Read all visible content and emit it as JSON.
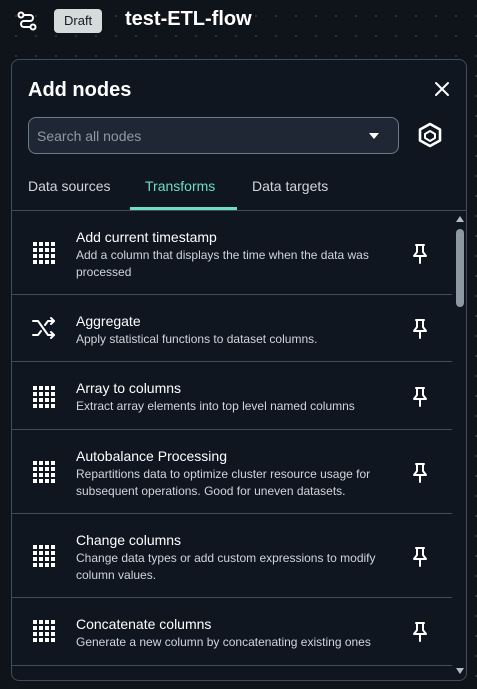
{
  "topbar": {
    "badge": "Draft",
    "flow_name": "test-ETL-flow",
    "flow_icon": "flow-graph-icon"
  },
  "panel": {
    "title": "Add nodes",
    "close_icon": "close-icon",
    "search": {
      "placeholder": "Search all nodes",
      "value": ""
    },
    "brand_icon": "hexagon-logo-icon",
    "tabs": [
      {
        "label": "Data sources",
        "active": false
      },
      {
        "label": "Transforms",
        "active": true
      },
      {
        "label": "Data targets",
        "active": false
      }
    ],
    "items": [
      {
        "title": "Add current timestamp",
        "description": "Add a column that displays the time when the data was processed",
        "icon": "grid-table-icon"
      },
      {
        "title": "Aggregate",
        "description": "Apply statistical functions to dataset columns.",
        "icon": "shuffle-icon"
      },
      {
        "title": "Array to columns",
        "description": "Extract array elements into top level named columns",
        "icon": "grid-table-icon"
      },
      {
        "title": "Autobalance Processing",
        "description": "Repartitions data to optimize cluster resource usage for subsequent operations. Good for uneven datasets.",
        "icon": "grid-table-icon"
      },
      {
        "title": "Change columns",
        "description": "Change data types or add custom expressions to modify column values.",
        "icon": "grid-table-icon"
      },
      {
        "title": "Concatenate columns",
        "description": "Generate a new column by concatenating existing ones",
        "icon": "grid-table-icon"
      }
    ]
  },
  "colors": {
    "accent": "#6eddc5",
    "background": "#0f141a",
    "panel": "#0f1620",
    "border": "#414d5c"
  }
}
